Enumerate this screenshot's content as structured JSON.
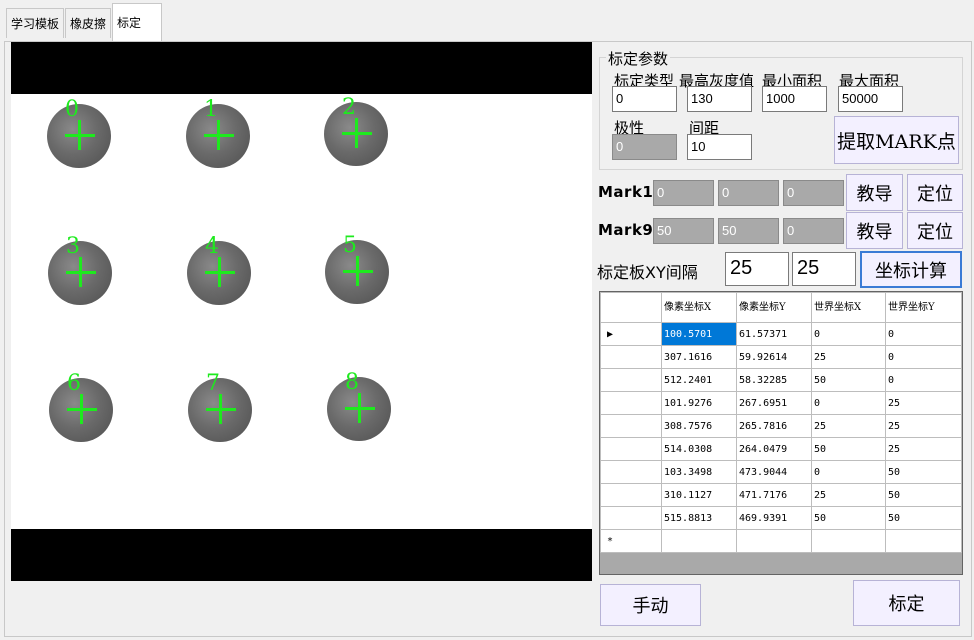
{
  "tabs": [
    {
      "label": "学习模板"
    },
    {
      "label": "橡皮擦"
    },
    {
      "label": "标定"
    }
  ],
  "viewer": {
    "marks": [
      {
        "label": "0"
      },
      {
        "label": "1"
      },
      {
        "label": "2"
      },
      {
        "label": "3"
      },
      {
        "label": "4"
      },
      {
        "label": "5"
      },
      {
        "label": "6"
      },
      {
        "label": "7"
      },
      {
        "label": "8"
      }
    ],
    "cross_color": "#1eea1e"
  },
  "params": {
    "group_title": "标定参数",
    "type_label": "标定类型",
    "type_value": "0",
    "max_gray_label": "最高灰度值",
    "max_gray_value": "130",
    "min_area_label": "最小面积",
    "min_area_value": "1000",
    "max_area_label": "最大面积",
    "max_area_value": "50000",
    "polarity_label": "极性",
    "polarity_value": "0",
    "spacing_label": "间距",
    "spacing_value": "10",
    "extract_button": "提取MARK点"
  },
  "mark1": {
    "label": "Mark1",
    "values": [
      "0",
      "0",
      "0"
    ],
    "teach": "教导",
    "locate": "定位"
  },
  "mark9": {
    "label": "Mark9",
    "values": [
      "50",
      "50",
      "0"
    ],
    "teach": "教导",
    "locate": "定位"
  },
  "board": {
    "label": "标定板XY间隔",
    "x": "25",
    "y": "25",
    "compute_button": "坐标计算"
  },
  "table": {
    "headers": [
      "像素坐标X",
      "像素坐标Y",
      "世界坐标X",
      "世界坐标Y"
    ],
    "rows": [
      [
        "100.5701",
        "61.57371",
        "0",
        "0"
      ],
      [
        "307.1616",
        "59.92614",
        "25",
        "0"
      ],
      [
        "512.2401",
        "58.32285",
        "50",
        "0"
      ],
      [
        "101.9276",
        "267.6951",
        "0",
        "25"
      ],
      [
        "308.7576",
        "265.7816",
        "25",
        "25"
      ],
      [
        "514.0308",
        "264.0479",
        "50",
        "25"
      ],
      [
        "103.3498",
        "473.9044",
        "0",
        "50"
      ],
      [
        "310.1127",
        "471.7176",
        "25",
        "50"
      ],
      [
        "515.8813",
        "469.9391",
        "50",
        "50"
      ]
    ],
    "current_row_marker": "▶",
    "new_row_marker": "*"
  },
  "buttons": {
    "manual": "手动",
    "calibrate": "标定"
  }
}
